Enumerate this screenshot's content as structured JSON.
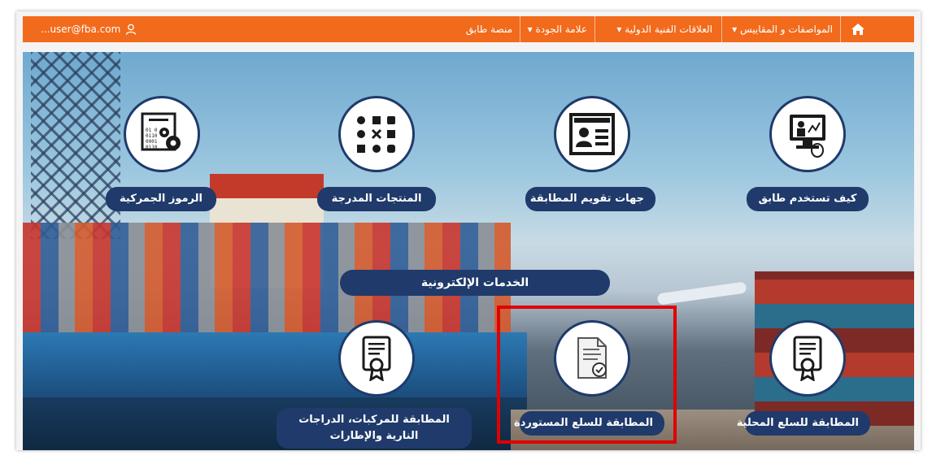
{
  "nav": {
    "home_icon": "home-icon",
    "items": [
      "المواصفات و المقاييس",
      "العلاقات الفنية الدولية",
      "علامة الجودة",
      "منصة طابق"
    ],
    "user_email": "...user@fba.com",
    "user_icon": "user-icon"
  },
  "services_top": [
    {
      "label": "كيف تستخدم طابق",
      "icon": "computer-screen-icon"
    },
    {
      "label": "جهات تقويم المطابقة",
      "icon": "id-card-icon"
    },
    {
      "label": "المنتجات المدرجة",
      "icon": "product-grid-icon"
    },
    {
      "label": "الرموز الجمركية",
      "icon": "customs-code-icon"
    }
  ],
  "section_title": "الخدمات الإلكترونية",
  "services_bottom": [
    {
      "label": "المطابقة للسلع المحلية",
      "icon": "certificate-icon"
    },
    {
      "label": "المطابقة للسلع المستوردة",
      "icon": "document-check-icon"
    },
    {
      "label": "المطابقة للمركبات، الدراجات النارية والإطارات",
      "icon": "certificate-icon"
    }
  ],
  "colors": {
    "nav": "#f26a1b",
    "navy": "#1f3a6b",
    "highlight": "#e00000"
  }
}
